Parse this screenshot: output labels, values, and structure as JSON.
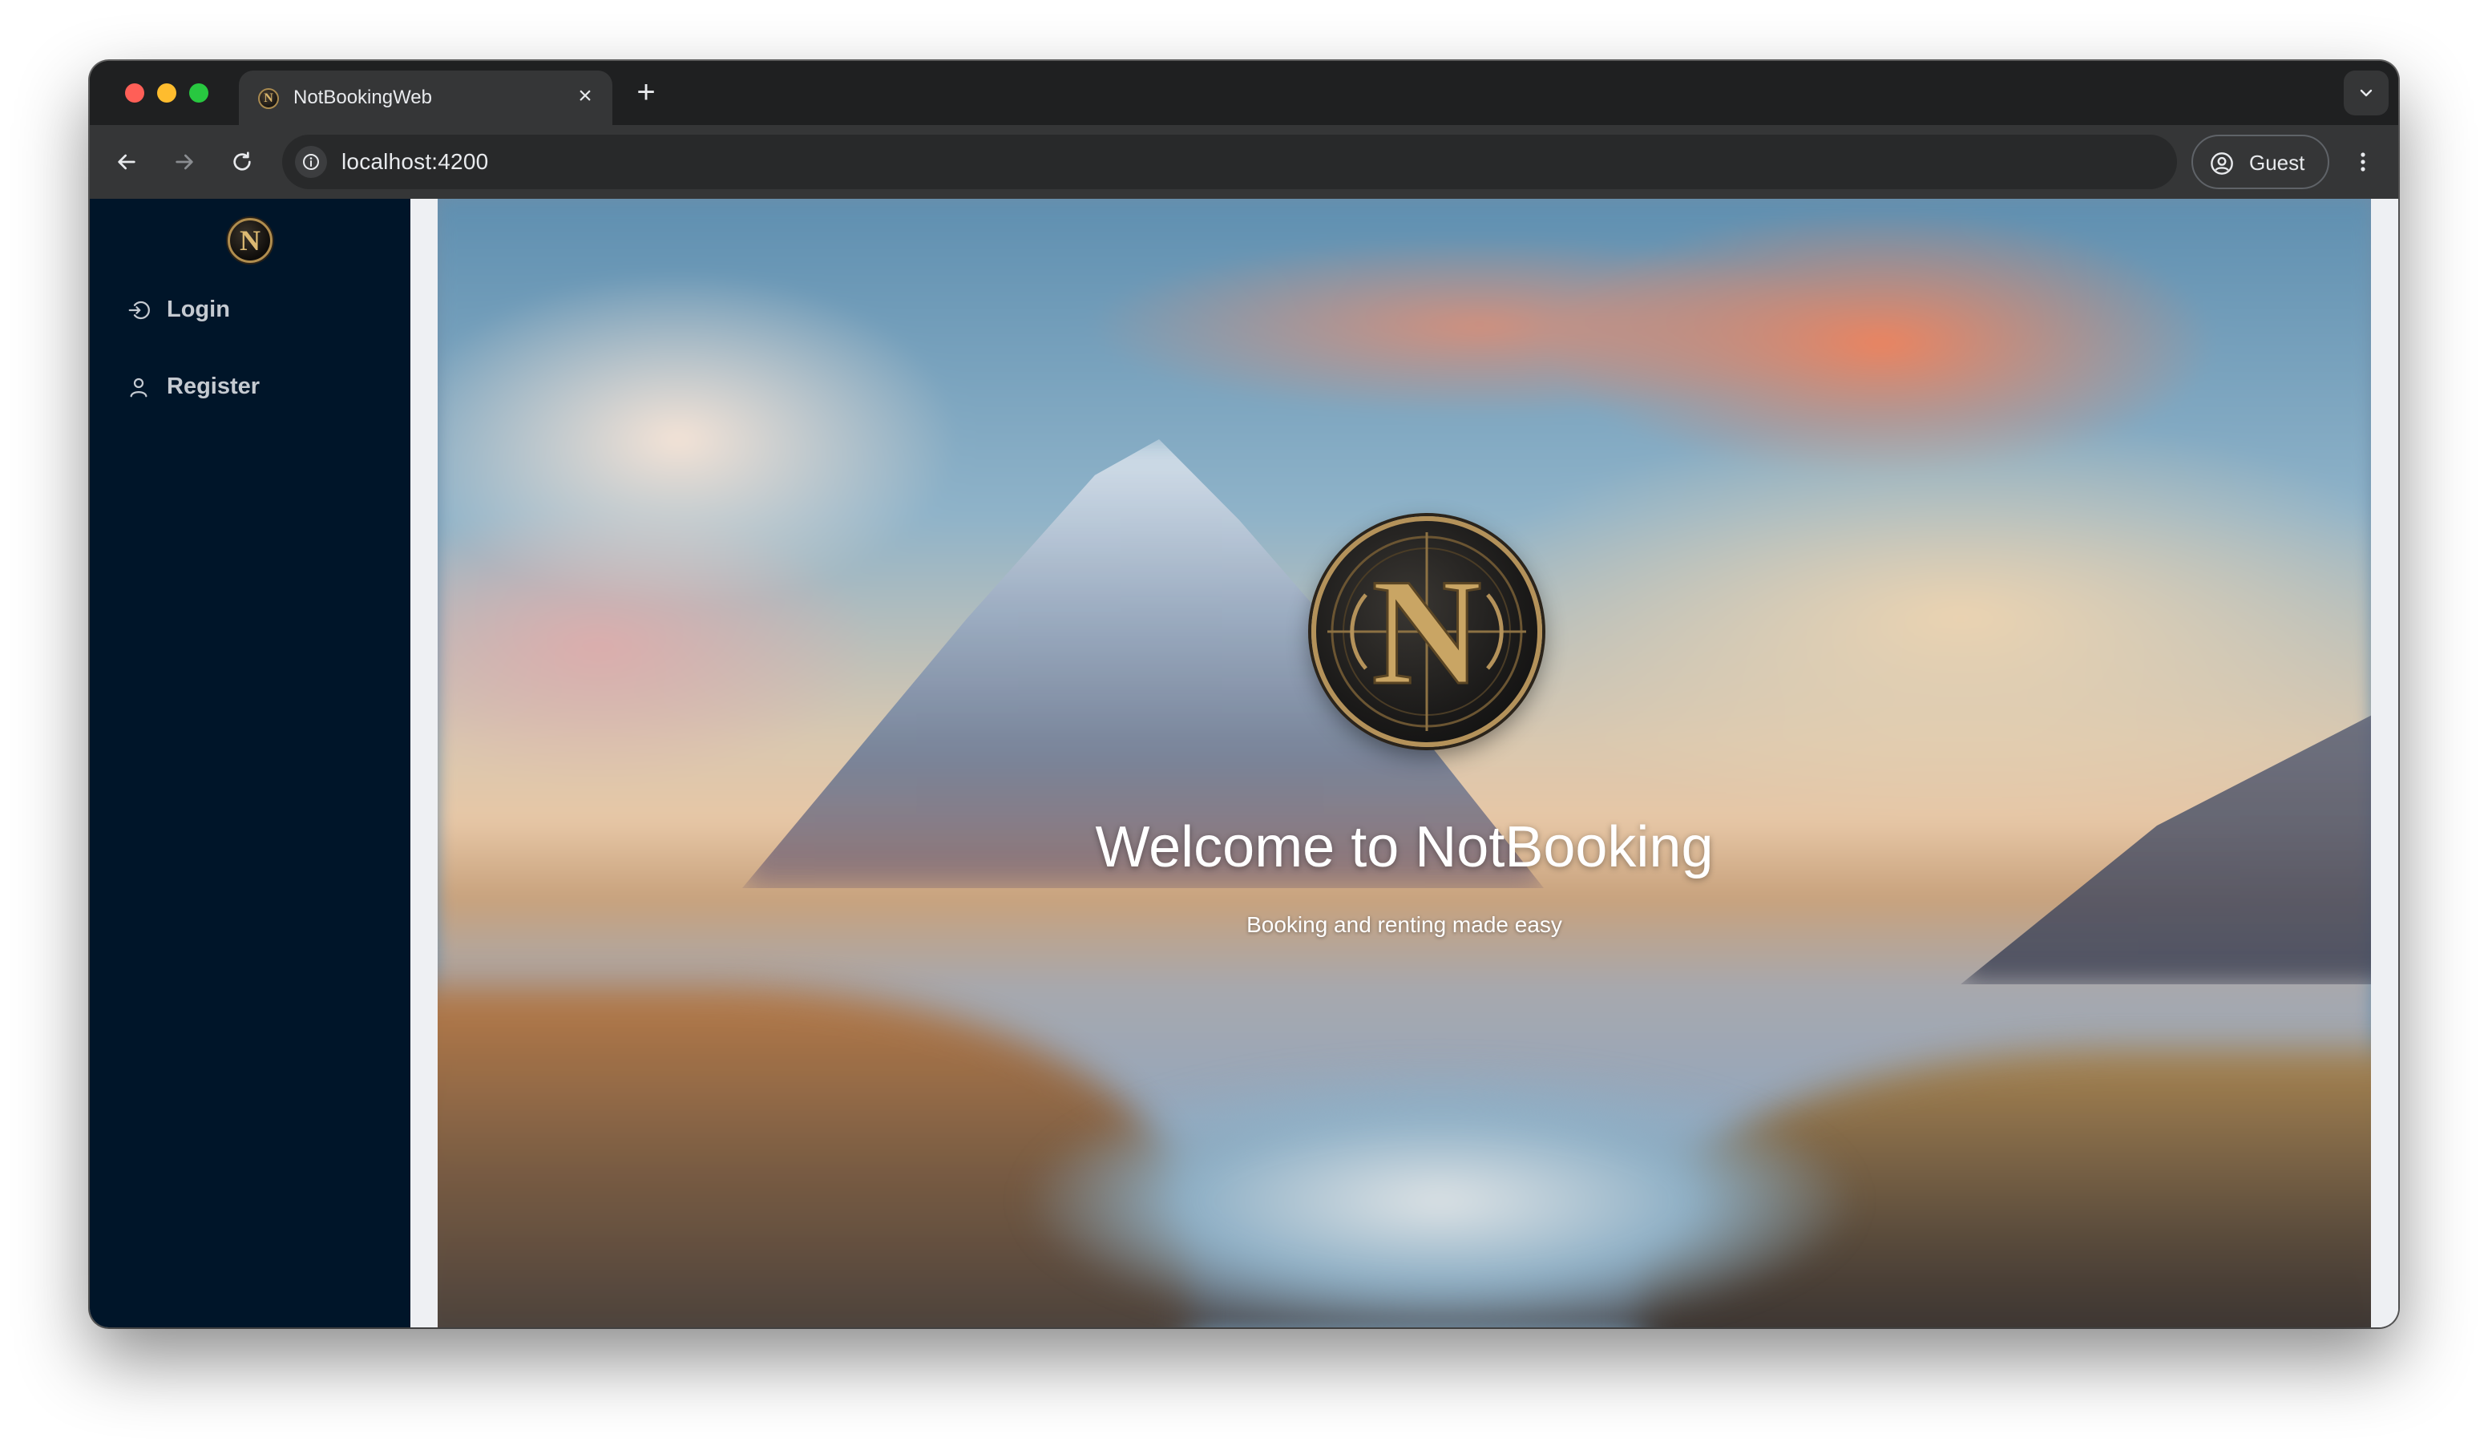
{
  "browser": {
    "tab": {
      "title": "NotBookingWeb",
      "close_glyph": "×",
      "favicon_icon": "notbooking-logo-icon"
    },
    "new_tab_glyph": "+",
    "address": {
      "url": "localhost:4200",
      "info_icon": "info-icon"
    },
    "profile": {
      "label": "Guest",
      "icon": "person-circle-icon"
    },
    "nav_icons": [
      "back-arrow-icon",
      "forward-arrow-icon",
      "reload-icon"
    ],
    "menu_icon": "kebab-menu-icon"
  },
  "sidebar": {
    "logo_letter": "N",
    "items": [
      {
        "label": "Login",
        "icon": "login-icon"
      },
      {
        "label": "Register",
        "icon": "user-icon"
      }
    ]
  },
  "hero": {
    "logo_letter": "N",
    "title": "Welcome to NotBooking",
    "subtitle": "Booking and renting made easy"
  },
  "colors": {
    "sidebar_bg": "#001529",
    "browser_chrome": "#1f2021",
    "toolbar": "#353637",
    "logo_gold": "#b4925a"
  }
}
